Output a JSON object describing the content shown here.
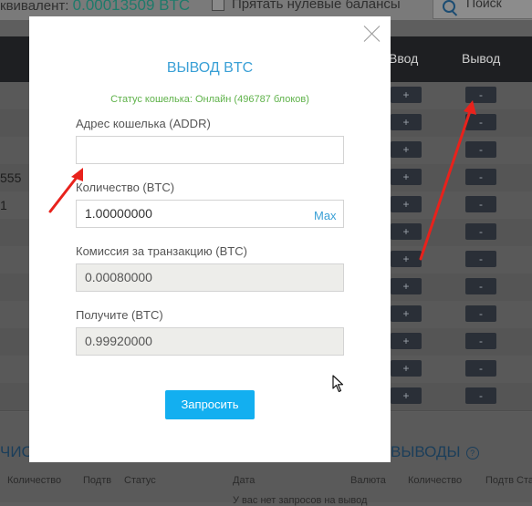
{
  "background": {
    "equivalent_label": "квивалент:",
    "equivalent_value": "0.00013509 BTC",
    "hide_zero_label": "Прятать нулевые балансы",
    "search_label": "Поиск",
    "col_deposit": "Ввод",
    "col_withdraw": "Вывод",
    "left_row_value_1": "555",
    "left_row_value_2": "1",
    "section_left": "ЧИС",
    "section_right": "ВЫВОДЫ",
    "left_cols": [
      "Количество",
      "Подтв",
      "Статус"
    ],
    "right_cols": [
      "Дата",
      "Валюта",
      "Количество",
      "Подтв",
      "Ста"
    ],
    "empty_text": "У вас нет запросов на вывод",
    "plus": "+",
    "minus": "-"
  },
  "modal": {
    "title": "ВЫВОД BTC",
    "status": "Статус кошелька: Онлайн (496787 блоков)",
    "address_label": "Адрес кошелька (ADDR)",
    "address_value": "",
    "amount_label": "Количество (BTC)",
    "amount_value": "1.00000000",
    "max_label": "Max",
    "fee_label": "Комиссия за транзакцию (BTC)",
    "fee_value": "0.00080000",
    "receive_label": "Получите (BTC)",
    "receive_value": "0.99920000",
    "submit_label": "Запросить"
  },
  "colors": {
    "accent": "#13aff0",
    "title": "#3aa0d6",
    "status_online": "#5fb24a",
    "annotation_arrow": "#e8221c"
  }
}
